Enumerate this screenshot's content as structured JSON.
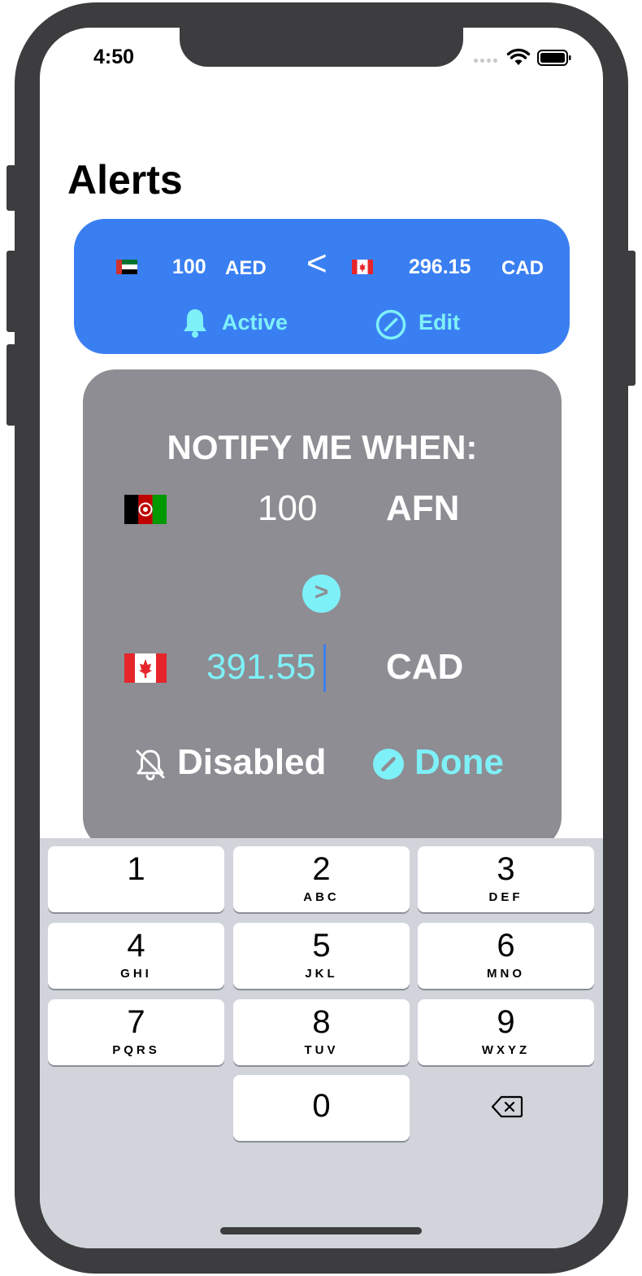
{
  "status_bar": {
    "time": "4:50",
    "icons": [
      "cellular-signal-icon",
      "wifi-icon",
      "battery-icon"
    ]
  },
  "page": {
    "title": "Alerts"
  },
  "alert_card": {
    "from_flag": "uae-flag-icon",
    "from_amount": "100",
    "from_code": "AED",
    "comparator": "<",
    "to_flag": "canada-flag-icon",
    "to_amount": "296.15",
    "to_code": "CAD",
    "status_icon": "bell-icon",
    "status_label": "Active",
    "edit_icon": "edit-icon",
    "edit_label": "Edit",
    "background_color": "#3a7ff2",
    "accent_color": "#7ef0f7"
  },
  "edit_card": {
    "heading": "NOTIFY ME WHEN:",
    "from_flag": "afghanistan-flag-icon",
    "from_amount": "100",
    "from_code": "AFN",
    "comparator": ">",
    "to_flag": "canada-flag-icon",
    "to_amount": "391.55",
    "to_code": "CAD",
    "status_icon": "bell-slash-icon",
    "status_label": "Disabled",
    "done_icon": "edit-filled-icon",
    "done_label": "Done",
    "background_color": "#8e8d93"
  },
  "keyboard": {
    "keys": [
      {
        "digit": "1",
        "letters": ""
      },
      {
        "digit": "2",
        "letters": "ABC"
      },
      {
        "digit": "3",
        "letters": "DEF"
      },
      {
        "digit": "4",
        "letters": "GHI"
      },
      {
        "digit": "5",
        "letters": "JKL"
      },
      {
        "digit": "6",
        "letters": "MNO"
      },
      {
        "digit": "7",
        "letters": "PQRS"
      },
      {
        "digit": "8",
        "letters": "TUV"
      },
      {
        "digit": "9",
        "letters": "WXYZ"
      },
      {
        "digit": "0",
        "letters": ""
      }
    ],
    "delete_icon": "backspace-icon"
  }
}
